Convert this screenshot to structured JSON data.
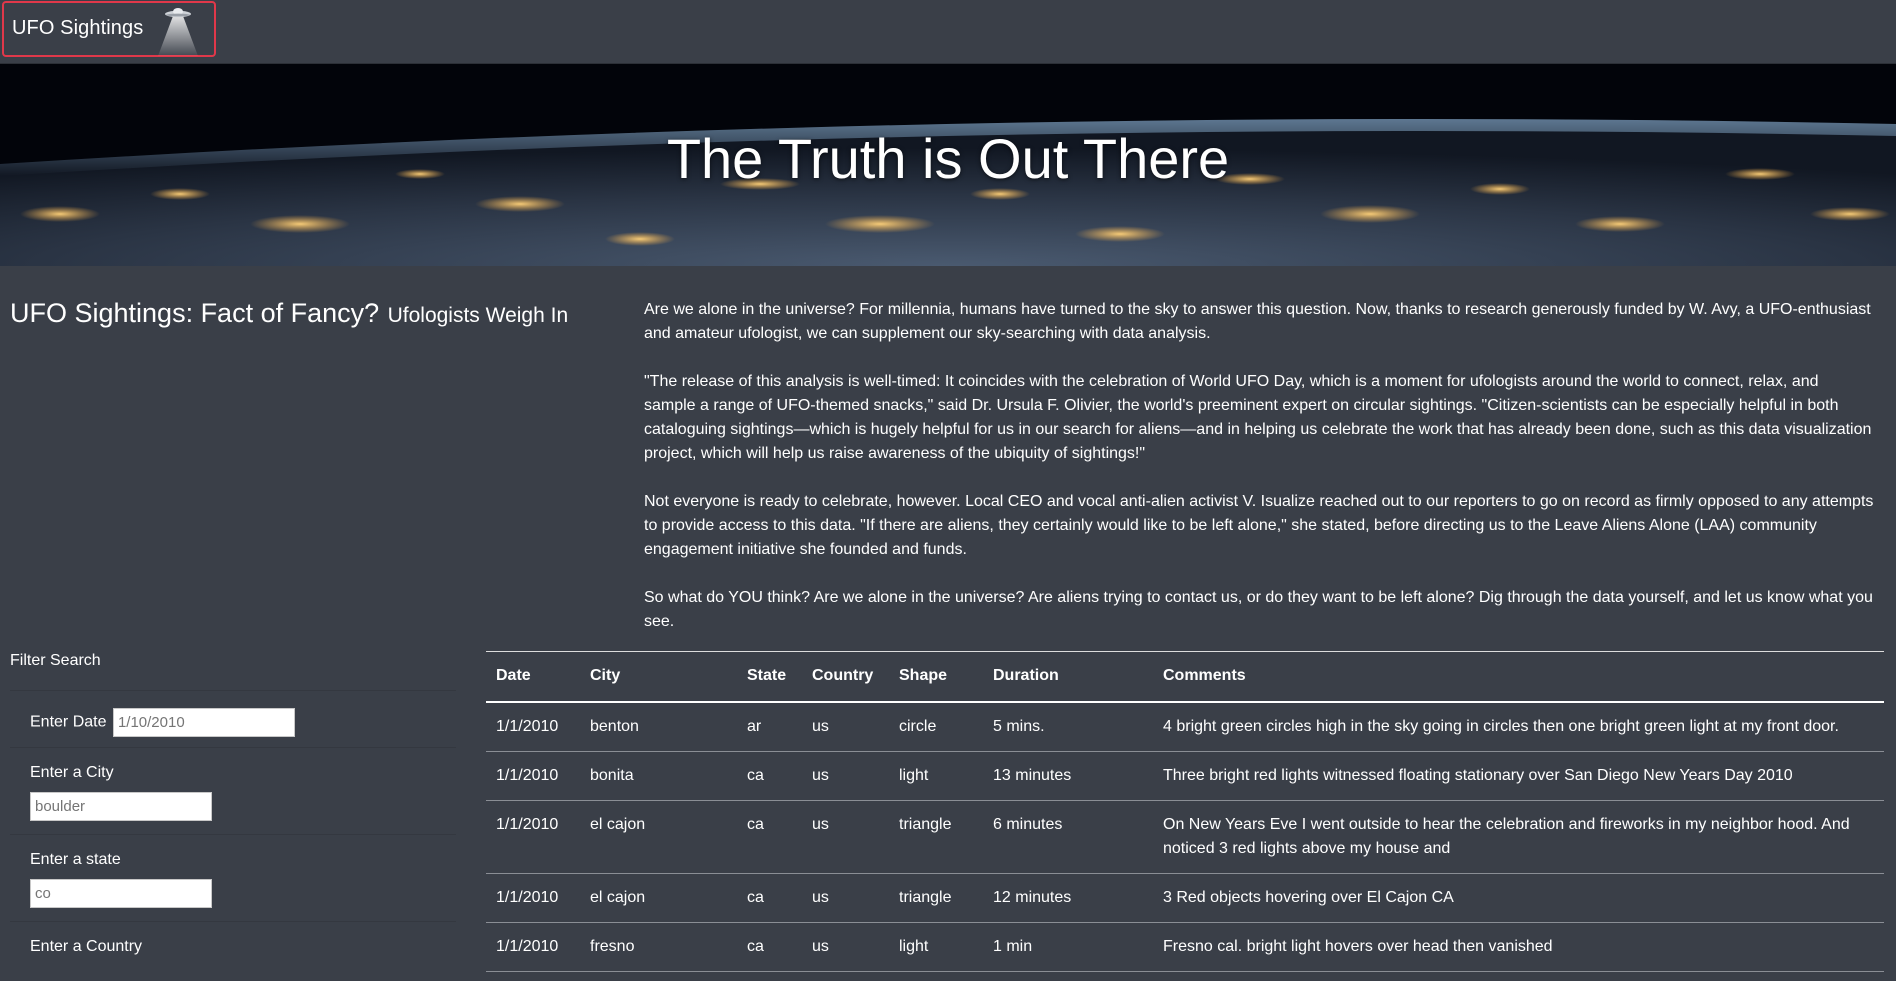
{
  "navbar": {
    "brand": "UFO Sightings"
  },
  "hero": {
    "title": "The Truth is Out There"
  },
  "intro": {
    "heading": "UFO Sightings: Fact of Fancy?",
    "subheading": "Ufologists Weigh In",
    "paragraphs": [
      "Are we alone in the universe? For millennia, humans have turned to the sky to answer this question. Now, thanks to research generously funded by W. Avy, a UFO-enthusiast and amateur ufologist, we can supplement our sky-searching with data analysis.",
      "\"The release of this analysis is well-timed: It coincides with the celebration of World UFO Day, which is a moment for ufologists around the world to connect, relax, and sample a range of UFO-themed snacks,\" said Dr. Ursula F. Olivier, the world's preeminent expert on circular sightings. \"Citizen-scientists can be especially helpful in both cataloguing sightings—which is hugely helpful for us in our search for aliens—and in helping us celebrate the work that has already been done, such as this data visualization project, which will help us raise awareness of the ubiquity of sightings!\"",
      "Not everyone is ready to celebrate, however. Local CEO and vocal anti-alien activist V. Isualize reached out to our reporters to go on record as firmly opposed to any attempts to provide access to this data. \"If there are aliens, they certainly would like to be left alone,\" she stated, before directing us to the Leave Aliens Alone (LAA) community engagement initiative she founded and funds.",
      "So what do YOU think? Are we alone in the universe? Are aliens trying to contact us, or do they want to be left alone? Dig through the data yourself, and let us know what you see."
    ]
  },
  "filters": {
    "title": "Filter Search",
    "date": {
      "label": "Enter Date",
      "placeholder": "1/10/2010"
    },
    "city": {
      "label": "Enter a City",
      "placeholder": "boulder"
    },
    "state": {
      "label": "Enter a state",
      "placeholder": "co"
    },
    "country": {
      "label": "Enter a Country"
    }
  },
  "table": {
    "headers": [
      "Date",
      "City",
      "State",
      "Country",
      "Shape",
      "Duration",
      "Comments"
    ],
    "rows": [
      [
        "1/1/2010",
        "benton",
        "ar",
        "us",
        "circle",
        "5 mins.",
        "4 bright green circles high in the sky going in circles then one bright green light at my front door."
      ],
      [
        "1/1/2010",
        "bonita",
        "ca",
        "us",
        "light",
        "13 minutes",
        "Three bright red lights witnessed floating stationary over San Diego New Years Day 2010"
      ],
      [
        "1/1/2010",
        "el cajon",
        "ca",
        "us",
        "triangle",
        "6 minutes",
        "On New Years Eve I went outside to hear the celebration and fireworks in my neighbor hood. And noticed 3 red lights above my house and"
      ],
      [
        "1/1/2010",
        "el cajon",
        "ca",
        "us",
        "triangle",
        "12 minutes",
        "3 Red objects hovering over El Cajon CA"
      ],
      [
        "1/1/2010",
        "fresno",
        "ca",
        "us",
        "light",
        "1 min",
        "Fresno cal. bright light hovers over head then vanished"
      ]
    ]
  }
}
